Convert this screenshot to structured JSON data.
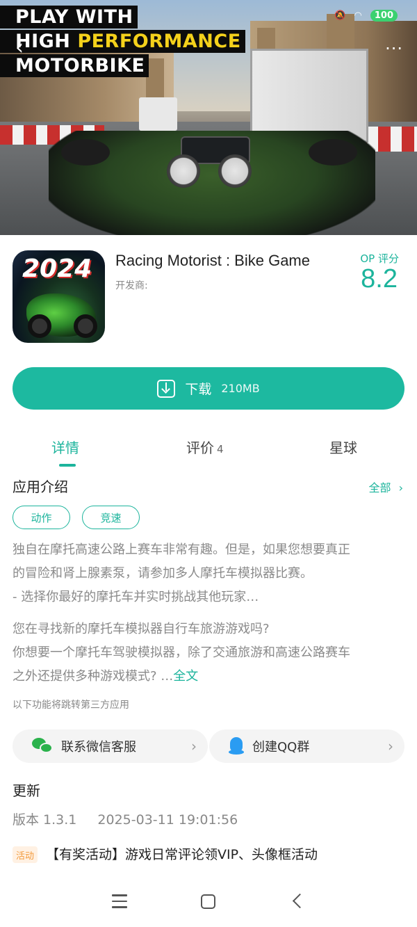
{
  "hero": {
    "headline_line1": "PLAY WITH",
    "headline_line2_white": "HIGH ",
    "headline_line2_yellow": "PERFORMANCE",
    "headline_line3": "MOTORBIKE"
  },
  "status_bar": {
    "battery": "100"
  },
  "app": {
    "icon_text": "2024",
    "title": "Racing Motorist : Bike Game",
    "developer_label": "开发商:",
    "rating_label": "OP 评分",
    "rating_value": "8.2"
  },
  "download": {
    "label": "下载",
    "size": "210MB"
  },
  "tabs": [
    {
      "label": "详情"
    },
    {
      "label": "评价",
      "count": "4"
    },
    {
      "label": "星球"
    }
  ],
  "intro": {
    "title": "应用介绍",
    "all_link": "全部",
    "tags": [
      "动作",
      "竞速"
    ],
    "para1_line1": "独自在摩托高速公路上赛车非常有趣。但是，如果您想要真正",
    "para1_line2": "的冒险和肾上腺素泵，请参加多人摩托车模拟器比赛。",
    "para1_line3": "- 选择你最好的摩托车并实时挑战其他玩家…",
    "para2_line1": "您在寻找新的摩托车模拟器自行车旅游游戏吗?",
    "para2_line2": "你想要一个摩托车驾驶模拟器，除了交通旅游和高速公路赛车",
    "para2_line3": "之外还提供多种游戏模式? …",
    "fulltext_link": "全文",
    "third_party_note": "以下功能将跳转第三方应用"
  },
  "links": {
    "wechat": "联系微信客服",
    "qq": "创建QQ群"
  },
  "update": {
    "title": "更新",
    "version": "版本 1.3.1",
    "date": "2025-03-11 19:01:56",
    "badge": "活动",
    "event": "【有奖活动】游戏日常评论领VIP、头像框活动"
  },
  "colors": {
    "accent": "#1cb49c",
    "download_button": "#1db9a0",
    "wechat_green": "#2bb24c",
    "qq_blue": "#2a9cf2",
    "hero_yellow": "#f4d11b",
    "badge_orange": "#f29a3c"
  }
}
